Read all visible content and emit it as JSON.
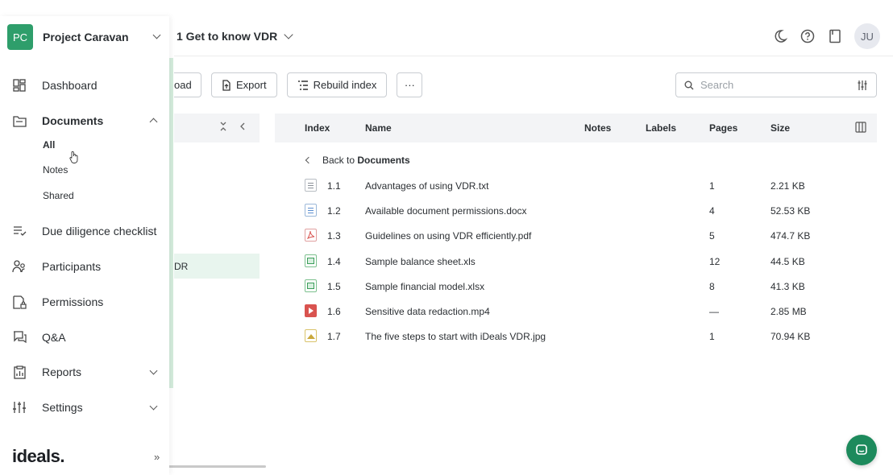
{
  "project": {
    "initials": "PC",
    "name": "Project Caravan"
  },
  "nav": {
    "dashboard": "Dashboard",
    "documents": "Documents",
    "documents_sub": [
      "All",
      "Notes",
      "Shared"
    ],
    "checklist": "Due diligence checklist",
    "participants": "Participants",
    "permissions": "Permissions",
    "qa": "Q&A",
    "reports": "Reports",
    "settings": "Settings"
  },
  "brand": {
    "logo": "ideals.",
    "collapse": "»"
  },
  "topbar": {
    "folder_title": "1 Get to know VDR",
    "user_initials": "JU"
  },
  "toolbar": {
    "upload_partial": "oad",
    "export": "Export",
    "rebuild_index": "Rebuild index",
    "more": "···"
  },
  "search": {
    "placeholder": "Search"
  },
  "tree": {
    "selected_partial": "DR"
  },
  "table": {
    "headers": {
      "index": "Index",
      "name": "Name",
      "notes": "Notes",
      "labels": "Labels",
      "pages": "Pages",
      "size": "Size"
    },
    "back": {
      "prefix": "Back to",
      "target": "Documents"
    },
    "rows": [
      {
        "index": "1.1",
        "name": "Advantages of using VDR.txt",
        "pages": "1",
        "size": "2.21 KB",
        "type": "txt"
      },
      {
        "index": "1.2",
        "name": "Available document permissions.docx",
        "pages": "4",
        "size": "52.53 KB",
        "type": "doc"
      },
      {
        "index": "1.3",
        "name": "Guidelines on using VDR efficiently.pdf",
        "pages": "5",
        "size": "474.7 KB",
        "type": "pdf"
      },
      {
        "index": "1.4",
        "name": "Sample balance sheet.xls",
        "pages": "12",
        "size": "44.5 KB",
        "type": "xls"
      },
      {
        "index": "1.5",
        "name": "Sample financial model.xlsx",
        "pages": "8",
        "size": "41.3 KB",
        "type": "xls"
      },
      {
        "index": "1.6",
        "name": "Sensitive data redaction.mp4",
        "pages": "—",
        "size": "2.85 MB",
        "type": "mp4"
      },
      {
        "index": "1.7",
        "name": "The five steps to start with iDeals VDR.jpg",
        "pages": "1",
        "size": "70.94 KB",
        "type": "jpg"
      }
    ]
  },
  "colors": {
    "brand_green": "#2e9e6b",
    "chat_green": "#1d8a5c",
    "selected_row": "#e8f5ee",
    "header_bg": "#f3f4f6"
  }
}
